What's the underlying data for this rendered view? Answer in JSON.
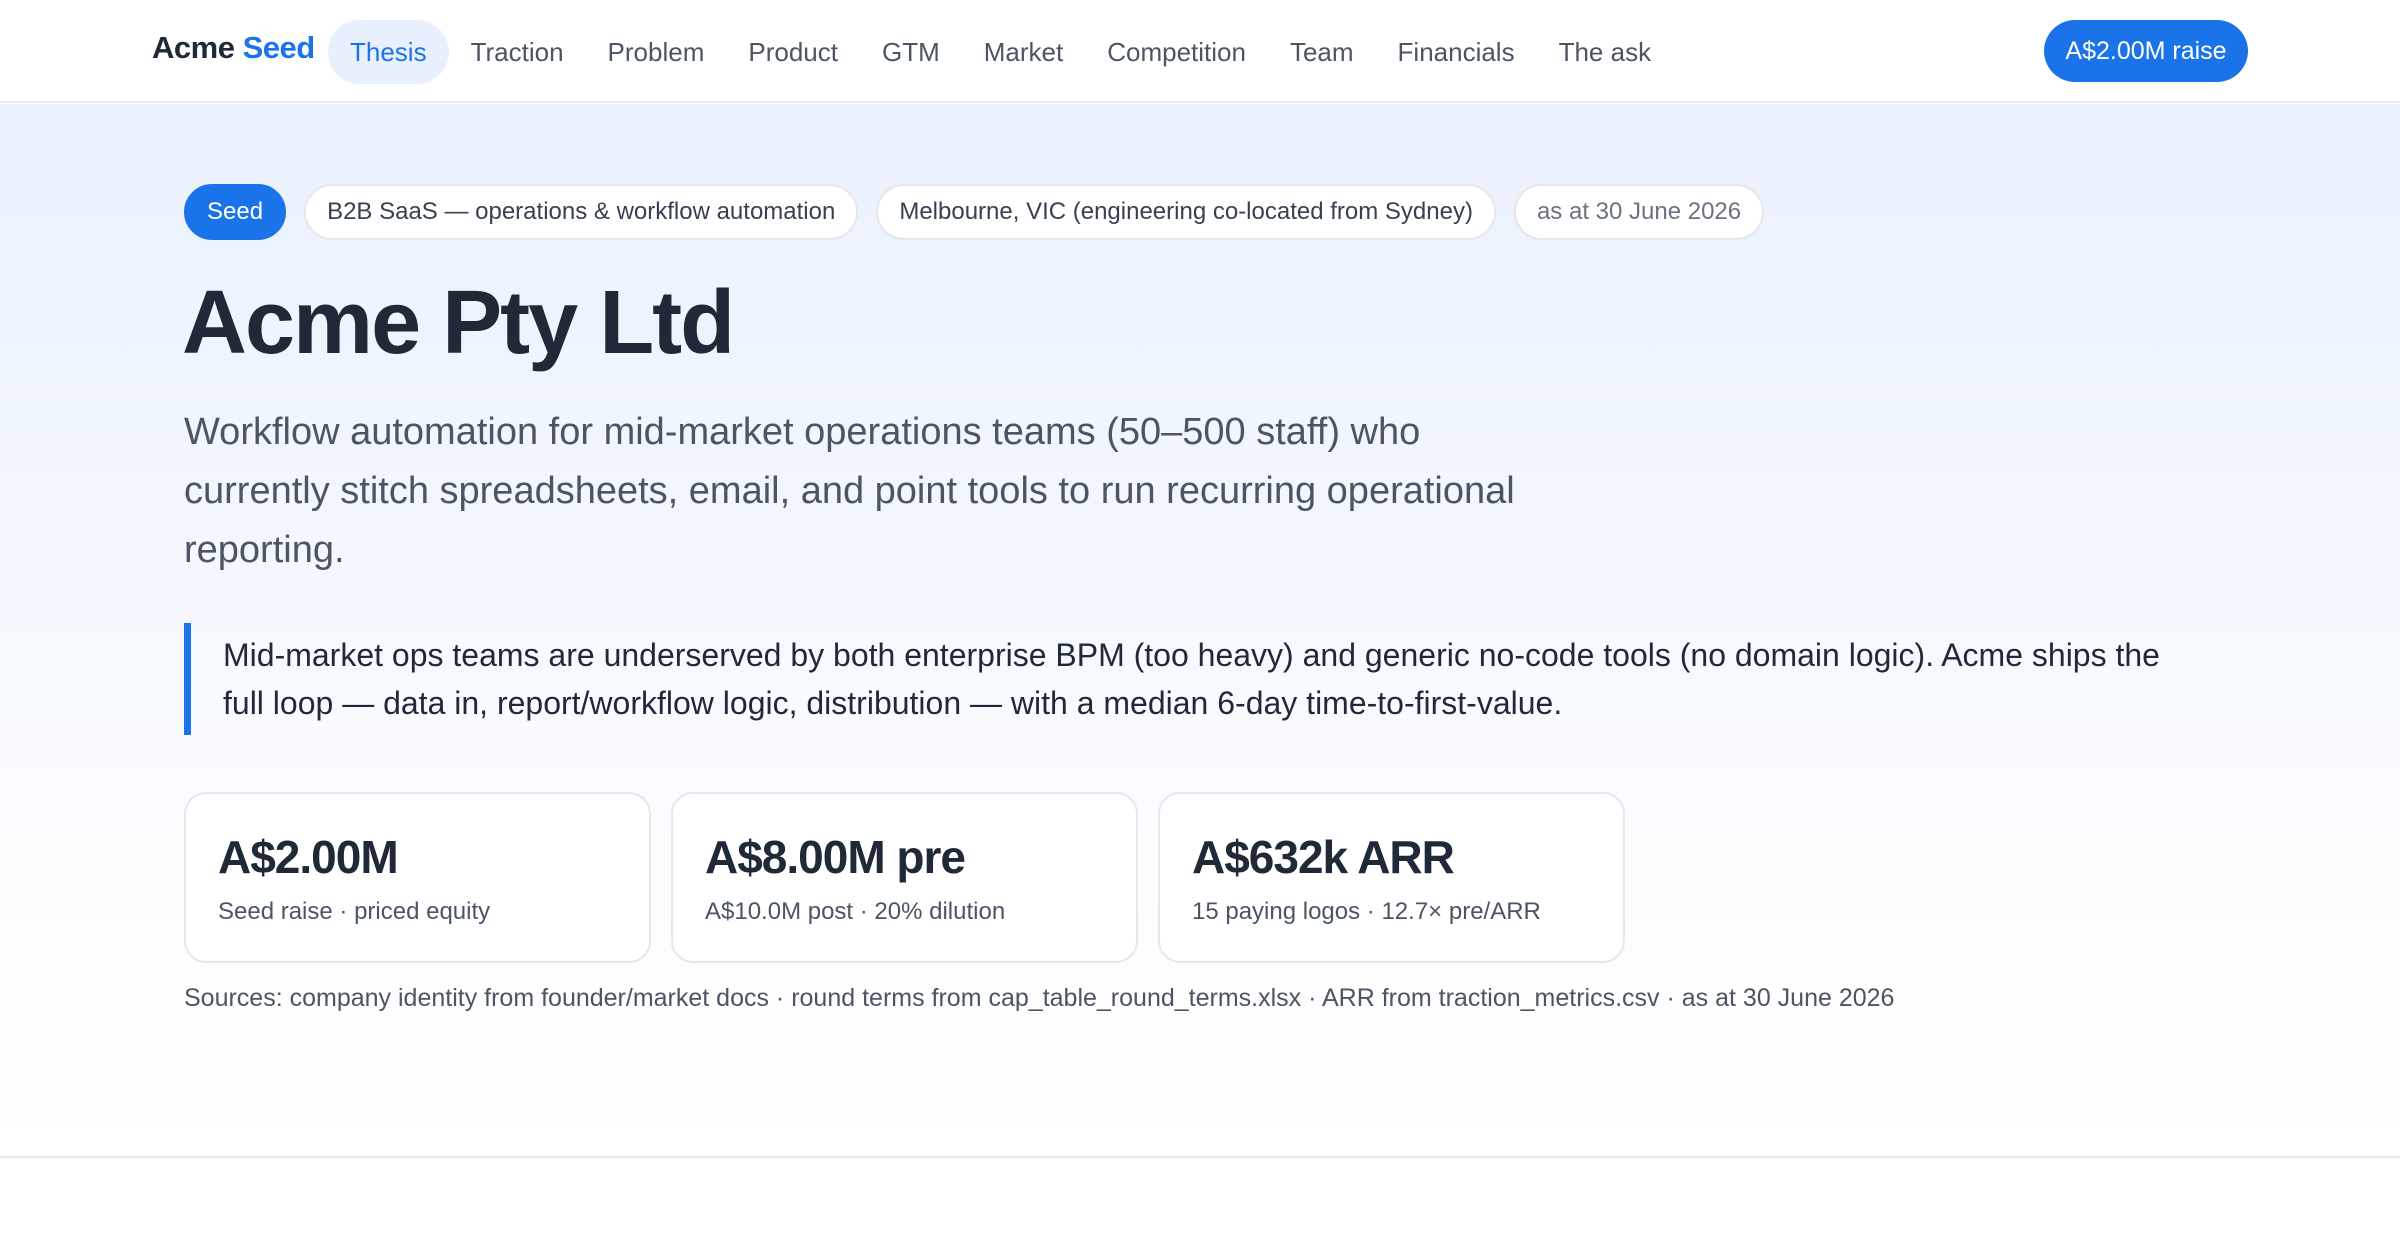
{
  "brand": {
    "name": "Acme",
    "accent": "Seed"
  },
  "nav": {
    "items": [
      {
        "label": "Thesis",
        "active": true
      },
      {
        "label": "Traction"
      },
      {
        "label": "Problem"
      },
      {
        "label": "Product"
      },
      {
        "label": "GTM"
      },
      {
        "label": "Market"
      },
      {
        "label": "Competition"
      },
      {
        "label": "Team"
      },
      {
        "label": "Financials"
      },
      {
        "label": "The ask"
      }
    ],
    "cta_label": "A$2.00M raise"
  },
  "hero": {
    "tags": [
      "Seed",
      "B2B SaaS — operations & workflow automation",
      "Melbourne, VIC (engineering co-located from Sydney)",
      "as at 30 June 2026"
    ],
    "title": "Acme Pty Ltd",
    "subtitle": "Workflow automation for mid-market operations teams (50–500 staff) who currently stitch spreadsheets, email, and point tools to run recurring operational reporting.",
    "thesis": "Mid-market ops teams are underserved by both enterprise BPM (too heavy) and generic no-code tools (no domain logic). Acme ships the full loop — data in, report/workflow logic, distribution — with a median 6-day time-to-first-value.",
    "cards": [
      {
        "value": "A$2.00M",
        "label": "Seed raise · priced equity"
      },
      {
        "value": "A$8.00M pre",
        "label": "A$10.0M post · 20% dilution"
      },
      {
        "value": "A$632k ARR",
        "label": "15 paying logos · 12.7× pre/ARR"
      }
    ],
    "sources": "Sources: company identity from founder/market docs · round terms from cap_table_round_terms.xlsx · ARR from traction_metrics.csv · as at 30 June 2026"
  },
  "colors": {
    "accent": "#1a73e8",
    "text": "#1f2937",
    "muted": "#4b5563",
    "border": "#e5e7eb"
  }
}
